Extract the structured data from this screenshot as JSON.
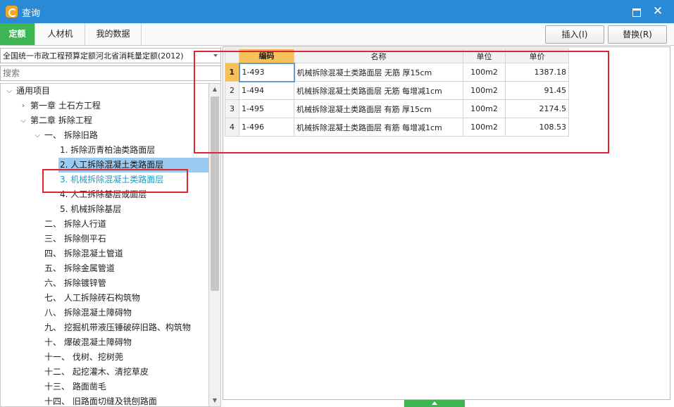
{
  "window": {
    "title": "查询",
    "close_glyph": "✕"
  },
  "tabs": [
    {
      "label": "定额",
      "active": true
    },
    {
      "label": "人材机",
      "active": false
    },
    {
      "label": "我的数据",
      "active": false
    }
  ],
  "toolbar": {
    "insert_label": "插入(I)",
    "replace_label": "替换(R)"
  },
  "quota_library": {
    "selected": "全国统一市政工程预算定额河北省消耗量定额(2012)"
  },
  "search": {
    "placeholder": "搜索",
    "value": ""
  },
  "tree": [
    {
      "label": "通用项目",
      "level": 0,
      "expander": "⌵"
    },
    {
      "label": "第一章  土石方工程",
      "level": 1,
      "expander": "›"
    },
    {
      "label": "第二章  拆除工程",
      "level": 1,
      "expander": "⌵"
    },
    {
      "label": "一、  拆除旧路",
      "level": 2,
      "expander": "⌵"
    },
    {
      "label": "1.  拆除沥青柏油类路面层",
      "level": 3,
      "expander": ""
    },
    {
      "label": "2.  人工拆除混凝土类路面层",
      "level": 3,
      "expander": "",
      "selected": true
    },
    {
      "label": "3.  机械拆除混凝土类路面层",
      "level": 3,
      "expander": "",
      "highlighted": true
    },
    {
      "label": "4.  人工拆除基层或面层",
      "level": 3,
      "expander": ""
    },
    {
      "label": "5.  机械拆除基层",
      "level": 3,
      "expander": ""
    },
    {
      "label": "二、  拆除人行道",
      "level": 2,
      "expander": ""
    },
    {
      "label": "三、  拆除侧平石",
      "level": 2,
      "expander": ""
    },
    {
      "label": "四、  拆除混凝土管道",
      "level": 2,
      "expander": ""
    },
    {
      "label": "五、  拆除金属管道",
      "level": 2,
      "expander": ""
    },
    {
      "label": "六、  拆除镀锌管",
      "level": 2,
      "expander": ""
    },
    {
      "label": "七、  人工拆除砖石构筑物",
      "level": 2,
      "expander": ""
    },
    {
      "label": "八、  拆除混凝土障碍物",
      "level": 2,
      "expander": ""
    },
    {
      "label": "九、  挖掘机带液压锤破碎旧路、构筑物",
      "level": 2,
      "expander": ""
    },
    {
      "label": "十、  爆破混凝土障碍物",
      "level": 2,
      "expander": ""
    },
    {
      "label": "十一、  伐树、挖树蔸",
      "level": 2,
      "expander": ""
    },
    {
      "label": "十二、  起挖灌木、清挖草皮",
      "level": 2,
      "expander": ""
    },
    {
      "label": "十三、  路面凿毛",
      "level": 2,
      "expander": ""
    },
    {
      "label": "十四、  旧路面切缝及铣刨路面",
      "level": 2,
      "expander": ""
    }
  ],
  "grid": {
    "headers": {
      "code": "编码",
      "name": "名称",
      "unit": "单位",
      "price": "单价"
    },
    "rows": [
      {
        "rn": "1",
        "code": "1-493",
        "name": "机械拆除混凝土类路面层 无筋 厚15cm",
        "unit": "100m2",
        "price": "1387.18"
      },
      {
        "rn": "2",
        "code": "1-494",
        "name": "机械拆除混凝土类路面层 无筋 每增减1cm",
        "unit": "100m2",
        "price": "91.45"
      },
      {
        "rn": "3",
        "code": "1-495",
        "name": "机械拆除混凝土类路面层 有筋 厚15cm",
        "unit": "100m2",
        "price": "2174.5"
      },
      {
        "rn": "4",
        "code": "1-496",
        "name": "机械拆除混凝土类路面层 有筋 每增减1cm",
        "unit": "100m2",
        "price": "108.53"
      }
    ]
  },
  "colors": {
    "accent_green": "#3db552",
    "title_blue": "#2b8ad6",
    "annotation_red": "#e0262a",
    "selection_blue": "#9ccbf2"
  }
}
